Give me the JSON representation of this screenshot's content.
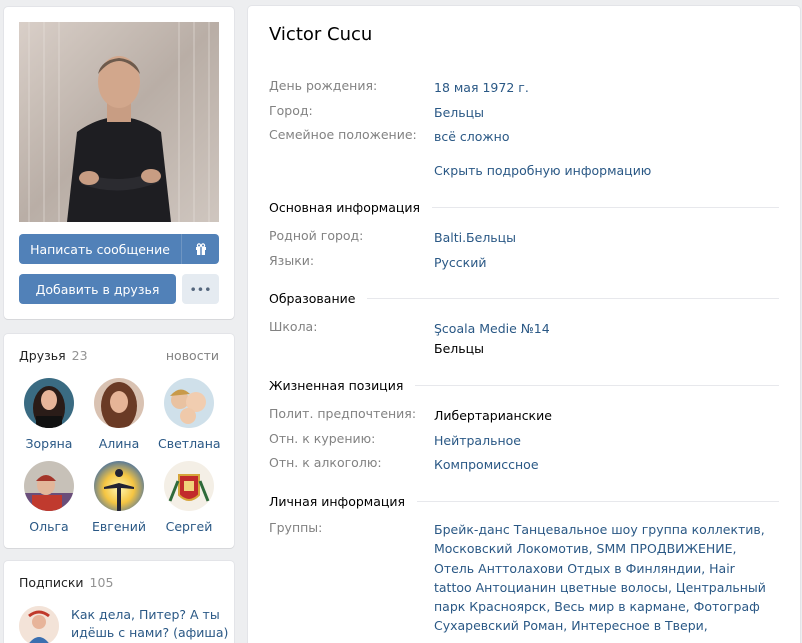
{
  "profile": {
    "name": "Victor Cucu",
    "message_button": "Написать сообщение",
    "add_friend_button": "Добавить в друзья",
    "more_button": "•••"
  },
  "friends": {
    "title": "Друзья",
    "count": "23",
    "link": "новости",
    "items": [
      {
        "name": "Зоряна"
      },
      {
        "name": "Алина"
      },
      {
        "name": "Светлана"
      },
      {
        "name": "Ольга"
      },
      {
        "name": "Евгений"
      },
      {
        "name": "Сергей"
      }
    ]
  },
  "subscriptions": {
    "title": "Подписки",
    "count": "105",
    "first_item": "Как дела, Питер? А ты идёшь с нами? (афиша)"
  },
  "info": {
    "birthday_label": "День рождения:",
    "birthday": "18 мая 1972 г.",
    "city_label": "Город:",
    "city": "Бельцы",
    "family_label": "Семейное положение:",
    "family": "всё сложно",
    "hide_details": "Скрыть подробную информацию",
    "basic_section": "Основная информация",
    "hometown_label": "Родной город:",
    "hometown": "Balti.Бельцы",
    "languages_label": "Языки:",
    "languages": "Русский",
    "education_section": "Образование",
    "school_label": "Школа:",
    "school": "Şcoala Medie №14",
    "school_city": "Бельцы",
    "position_section": "Жизненная позиция",
    "politics_label": "Полит. предпочтения:",
    "politics": "Либертарианские",
    "smoking_label": "Отн. к курению:",
    "smoking": "Нейтральное",
    "alcohol_label": "Отн. к алкоголю:",
    "alcohol": "Компромиссное",
    "personal_section": "Личная информация",
    "groups_label": "Группы:",
    "groups": "Брейк-данс Танцевальное шоу группа коллектив, Московский Локомотив, SMM ПРОДВИЖЕНИЕ, Отель Анттолахови Отдых в Финляндии, Hair tattoo Антоцианин цветные волосы, Центральный парк Красноярск, Весь мир в кармане, Фотограф Сухаревский Роман, Интересное в Твери,"
  }
}
